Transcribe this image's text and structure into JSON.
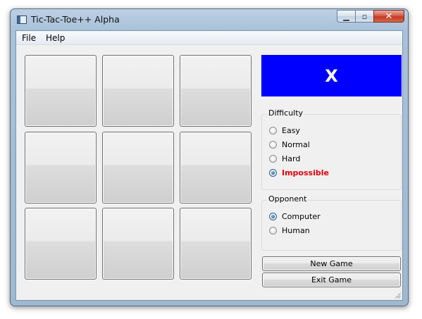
{
  "window": {
    "title": "Tic-Tac-Toe++ Alpha",
    "caption": {
      "minimize_glyph": "▁",
      "maximize_glyph": "▫",
      "close_glyph": "✕"
    }
  },
  "menu": {
    "items": [
      {
        "label": "File"
      },
      {
        "label": "Help"
      }
    ]
  },
  "board": {
    "cells": [
      "",
      "",
      "",
      "",
      "",
      "",
      "",
      "",
      ""
    ]
  },
  "turn": {
    "symbol": "X",
    "color": "#0000ff"
  },
  "difficulty": {
    "title": "Difficulty",
    "options": [
      {
        "label": "Easy",
        "selected": false
      },
      {
        "label": "Normal",
        "selected": false
      },
      {
        "label": "Hard",
        "selected": false
      },
      {
        "label": "Impossible",
        "selected": true,
        "color": "#e8000c"
      }
    ]
  },
  "opponent": {
    "title": "Opponent",
    "options": [
      {
        "label": "Computer",
        "selected": true
      },
      {
        "label": "Human",
        "selected": false
      }
    ]
  },
  "buttons": {
    "new_game": "New Game",
    "exit_game": "Exit Game"
  }
}
